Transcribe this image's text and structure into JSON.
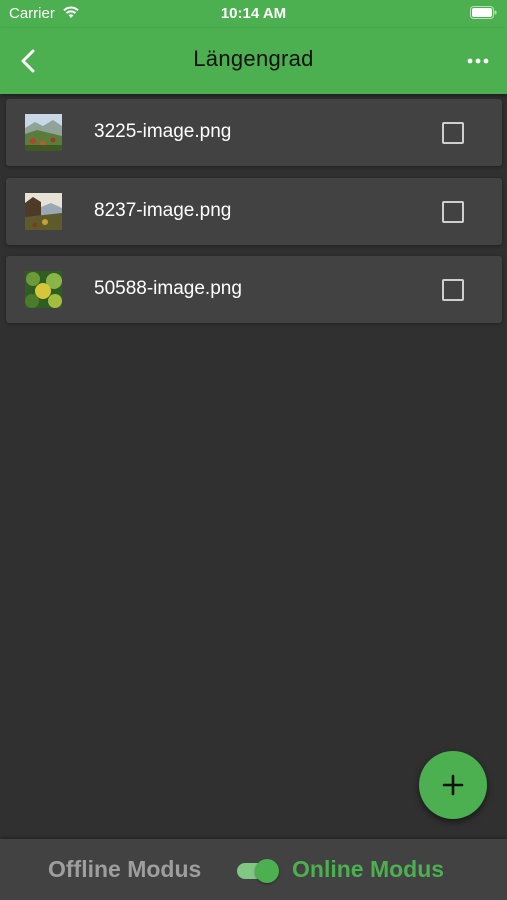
{
  "status_bar": {
    "carrier": "Carrier",
    "time": "10:14 AM"
  },
  "app_bar": {
    "title": "Längengrad"
  },
  "files": [
    {
      "name": "3225-image.png",
      "checked": false,
      "thumb_icon": "landscape-photo-thumbnail"
    },
    {
      "name": "8237-image.png",
      "checked": false,
      "thumb_icon": "mountain-photo-thumbnail"
    },
    {
      "name": "50588-image.png",
      "checked": false,
      "thumb_icon": "plant-photo-thumbnail"
    }
  ],
  "bottom_bar": {
    "offline_label": "Offline Modus",
    "online_label": "Online Modus",
    "online_enabled": true
  },
  "colors": {
    "accent": "#4caf50",
    "background": "#303030",
    "card": "#424242"
  }
}
